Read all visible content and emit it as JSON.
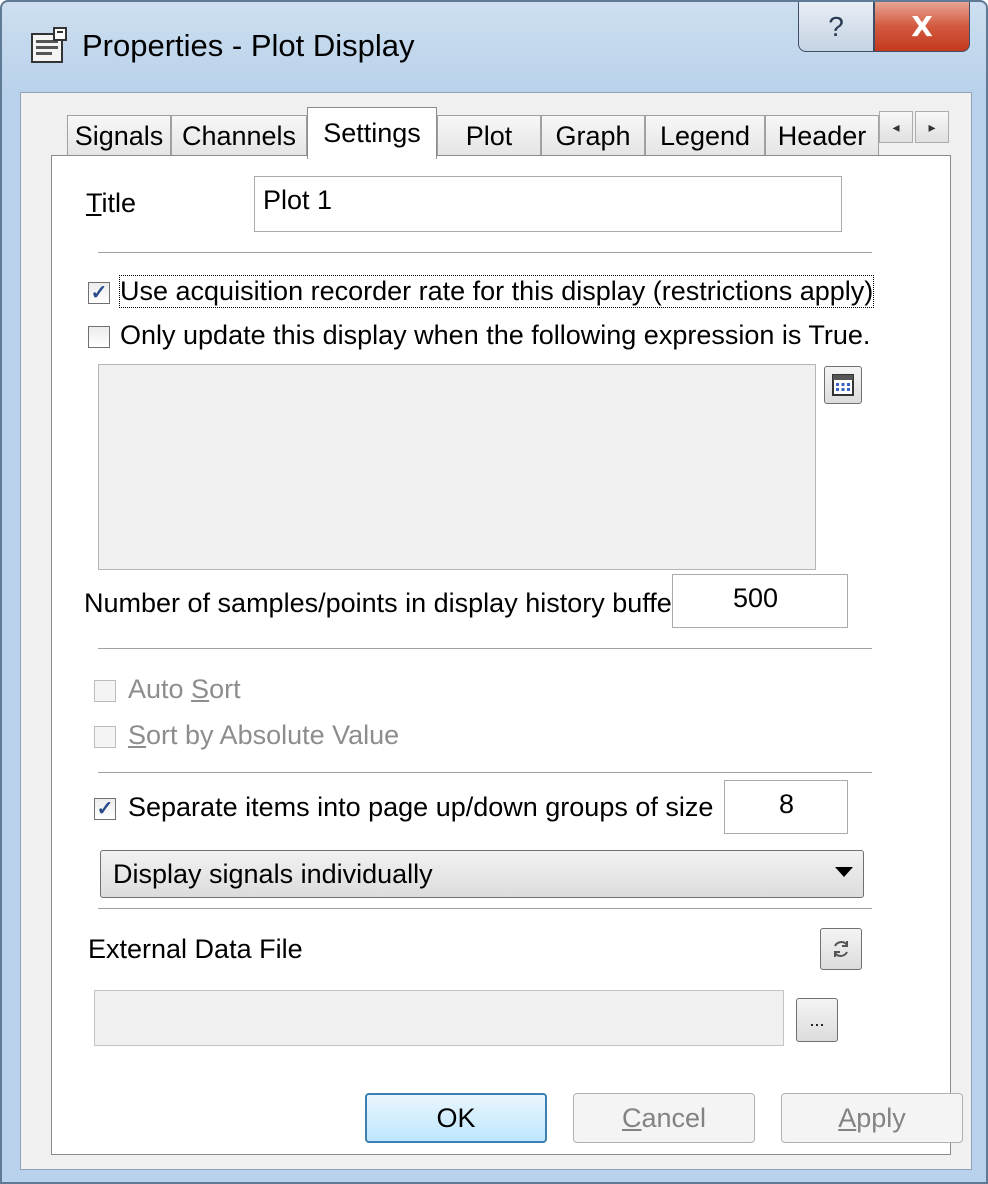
{
  "window": {
    "title": "Properties - Plot Display",
    "help_button": "?",
    "close_button": "X"
  },
  "tabs": [
    {
      "label": "Signals"
    },
    {
      "label": "Channels"
    },
    {
      "label": "Settings",
      "active": true
    },
    {
      "label": "Plot"
    },
    {
      "label": "Graph"
    },
    {
      "label": "Legend"
    },
    {
      "label": "Header"
    }
  ],
  "settings": {
    "title_label": "Title",
    "title_mnemonic": "T",
    "title_label_rest": "itle",
    "title_value": "Plot 1",
    "use_acquisition_rate_label": "Use acquisition recorder rate for this display (restrictions apply)",
    "use_acquisition_rate_checked": true,
    "only_update_label": "Only update this display when the following expression is True.",
    "only_update_checked": false,
    "expression_value": "",
    "history_buffer_label": "Number of samples/points in display history buffer",
    "history_buffer_value": "500",
    "auto_sort_prefix": "Auto ",
    "auto_sort_mnemonic": "S",
    "auto_sort_rest": "ort",
    "auto_sort_checked": false,
    "sort_abs_mnemonic": "S",
    "sort_abs_rest": "ort by Absolute Value",
    "sort_abs_checked": false,
    "separate_items_label": "Separate items into page up/down groups of size",
    "separate_items_checked": true,
    "group_size_value": "8",
    "display_mode_selected": "Display signals individually",
    "external_file_label": "External Data File",
    "external_file_value": "",
    "browse_label": "..."
  },
  "buttons": {
    "ok": "OK",
    "cancel_mnemonic": "C",
    "cancel_rest": "ancel",
    "apply_mnemonic": "A",
    "apply_rest": "pply"
  },
  "colors": {
    "title_bar": "#b9d1ea",
    "close_button": "#c4391e",
    "default_button": "#3c7fb1",
    "check_mark": "#2a4c8c"
  }
}
